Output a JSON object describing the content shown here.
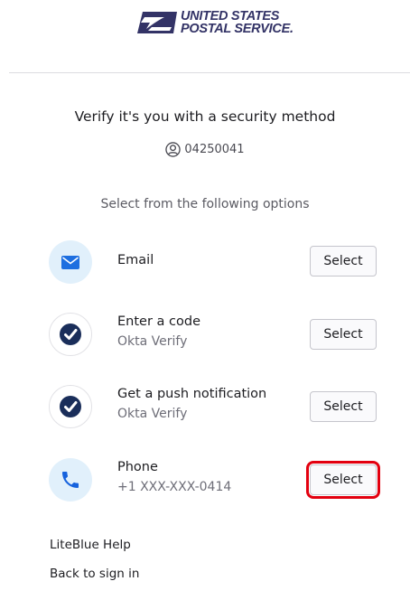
{
  "brand": {
    "line1": "UNITED STATES",
    "line2": "POSTAL SERVICE."
  },
  "title": "Verify it's you with a security method",
  "identifier": {
    "icon": "user-circle-icon",
    "value": "04250041"
  },
  "subtitle": "Select from the following options",
  "options": [
    {
      "icon": "envelope-icon",
      "title": "Email",
      "subtitle": "",
      "button": "Select"
    },
    {
      "icon": "okta-verify-check-icon",
      "title": "Enter a code",
      "subtitle": "Okta Verify",
      "button": "Select"
    },
    {
      "icon": "okta-verify-check-icon",
      "title": "Get a push notification",
      "subtitle": "Okta Verify",
      "button": "Select"
    },
    {
      "icon": "phone-icon",
      "title": "Phone",
      "subtitle": "+1 XXX-XXX-0414",
      "button": "Select"
    }
  ],
  "footer": {
    "help": "LiteBlue Help",
    "back": "Back to sign in"
  },
  "colors": {
    "brand_navy": "#333366",
    "icon_bubble": "#e1f0fb",
    "okta_blue": "#1a2e5a",
    "phone_blue": "#1662dd",
    "highlight": "#e3000f"
  }
}
